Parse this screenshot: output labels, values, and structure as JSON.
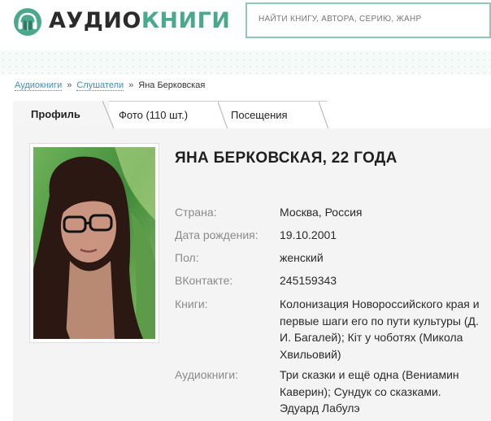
{
  "header": {
    "logo_part1": "АУДИО",
    "logo_part2": "КНИГИ",
    "search_placeholder": "НАЙТИ КНИГУ, АВТОРА, СЕРИЮ, ЖАНР"
  },
  "breadcrumb": {
    "items": [
      "Аудиокниги",
      "Слушатели"
    ],
    "current": "Яна Берковская",
    "separator": "»"
  },
  "tabs": [
    "Профиль",
    "Фото (110 шт.)",
    "Посещения"
  ],
  "profile": {
    "name": "ЯНА БЕРКОВСКАЯ, 22 ГОДА",
    "fields": [
      {
        "label": "Страна:",
        "value": "Москва, Россия"
      },
      {
        "label": "Дата рождения:",
        "value": "19.10.2001"
      },
      {
        "label": "Пол:",
        "value": "женский"
      },
      {
        "label": "ВКонтакте:",
        "value": "245159343"
      },
      {
        "label": "Книги:",
        "value": "Колонизация Новороссийского края и первые шаги его по пути культуры (Д. И. Багалей); Кіт у чоботях (Микола Хвильовий)"
      },
      {
        "label": "Аудиокниги:",
        "value": "Три сказки и ещё одна (Вениамин Каверин); Сундук со сказками. Эдуард Лабулэ"
      }
    ]
  },
  "colors": {
    "brand_green": "#4aa98b",
    "link_blue": "#3f8fb5",
    "search_border": "#8fc9b4"
  },
  "icons": {
    "logo": "headphones-book-icon"
  }
}
